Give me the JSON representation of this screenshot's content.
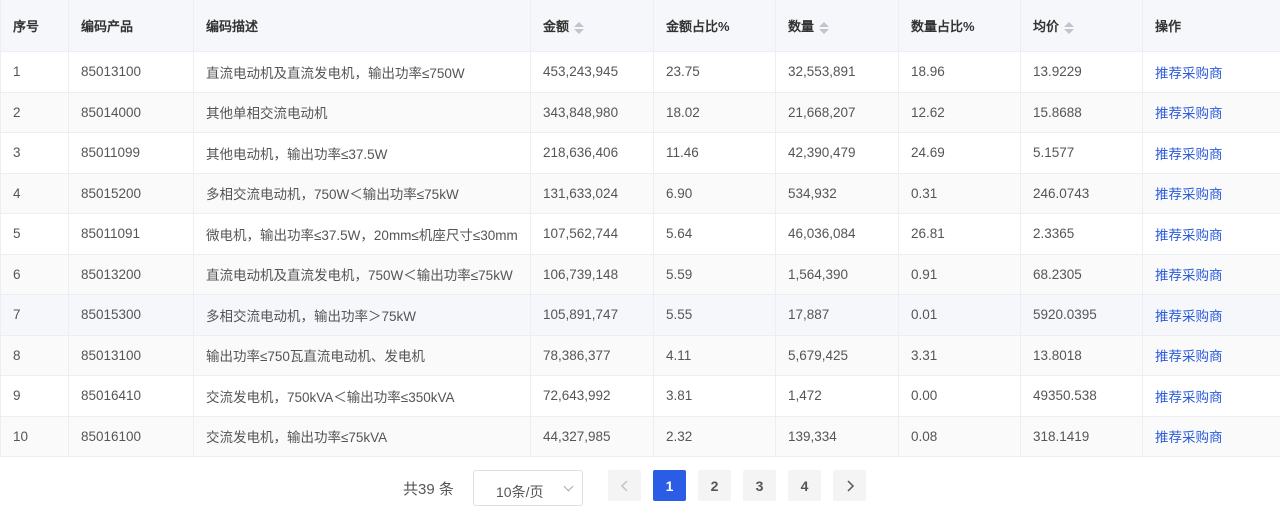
{
  "columns": [
    "序号",
    "编码产品",
    "编码描述",
    "金额",
    "金额占比%",
    "数量",
    "数量占比%",
    "均价",
    "操作"
  ],
  "rows": [
    {
      "index": "1",
      "code": "85013100",
      "desc": "直流电动机及直流发电机，输出功率≤750W",
      "amount": "453,243,945",
      "amount_pct": "23.75",
      "qty": "32,553,891",
      "qty_pct": "18.96",
      "avg": "13.9229",
      "action": "推荐采购商"
    },
    {
      "index": "2",
      "code": "85014000",
      "desc": "其他单相交流电动机",
      "amount": "343,848,980",
      "amount_pct": "18.02",
      "qty": "21,668,207",
      "qty_pct": "12.62",
      "avg": "15.8688",
      "action": "推荐采购商"
    },
    {
      "index": "3",
      "code": "85011099",
      "desc": "其他电动机，输出功率≤37.5W",
      "amount": "218,636,406",
      "amount_pct": "11.46",
      "qty": "42,390,479",
      "qty_pct": "24.69",
      "avg": "5.1577",
      "action": "推荐采购商"
    },
    {
      "index": "4",
      "code": "85015200",
      "desc": "多相交流电动机，750W＜输出功率≤75kW",
      "amount": "131,633,024",
      "amount_pct": "6.90",
      "qty": "534,932",
      "qty_pct": "0.31",
      "avg": "246.0743",
      "action": "推荐采购商"
    },
    {
      "index": "5",
      "code": "85011091",
      "desc": "微电机，输出功率≤37.5W，20mm≤机座尺寸≤30mm",
      "amount": "107,562,744",
      "amount_pct": "5.64",
      "qty": "46,036,084",
      "qty_pct": "26.81",
      "avg": "2.3365",
      "action": "推荐采购商"
    },
    {
      "index": "6",
      "code": "85013200",
      "desc": "直流电动机及直流发电机，750W＜输出功率≤75kW",
      "amount": "106,739,148",
      "amount_pct": "5.59",
      "qty": "1,564,390",
      "qty_pct": "0.91",
      "avg": "68.2305",
      "action": "推荐采购商"
    },
    {
      "index": "7",
      "code": "85015300",
      "desc": "多相交流电动机，输出功率＞75kW",
      "amount": "105,891,747",
      "amount_pct": "5.55",
      "qty": "17,887",
      "qty_pct": "0.01",
      "avg": "5920.0395",
      "action": "推荐采购商"
    },
    {
      "index": "8",
      "code": "85013100",
      "desc": "输出功率≤750瓦直流电动机、发电机",
      "amount": "78,386,377",
      "amount_pct": "4.11",
      "qty": "5,679,425",
      "qty_pct": "3.31",
      "avg": "13.8018",
      "action": "推荐采购商"
    },
    {
      "index": "9",
      "code": "85016410",
      "desc": "交流发电机，750kVA＜输出功率≤350kVA",
      "amount": "72,643,992",
      "amount_pct": "3.81",
      "qty": "1,472",
      "qty_pct": "0.00",
      "avg": "49350.538",
      "action": "推荐采购商"
    },
    {
      "index": "10",
      "code": "85016100",
      "desc": "交流发电机，输出功率≤75kVA",
      "amount": "44,327,985",
      "amount_pct": "2.32",
      "qty": "139,334",
      "qty_pct": "0.08",
      "avg": "318.1419",
      "action": "推荐采购商"
    }
  ],
  "pagination": {
    "total": "共39 条",
    "page_size": "10条/页",
    "pages": [
      "1",
      "2",
      "3",
      "4"
    ],
    "current": "1"
  },
  "colors": {
    "link": "#2d5cdb",
    "active_page": "#2b5ce6",
    "header_bg": "#f5f7fa"
  },
  "icons": {
    "sort": "sort-caret-icon",
    "prev": "chevron-left-icon",
    "next": "chevron-right-icon",
    "dropdown": "chevron-down-icon"
  }
}
